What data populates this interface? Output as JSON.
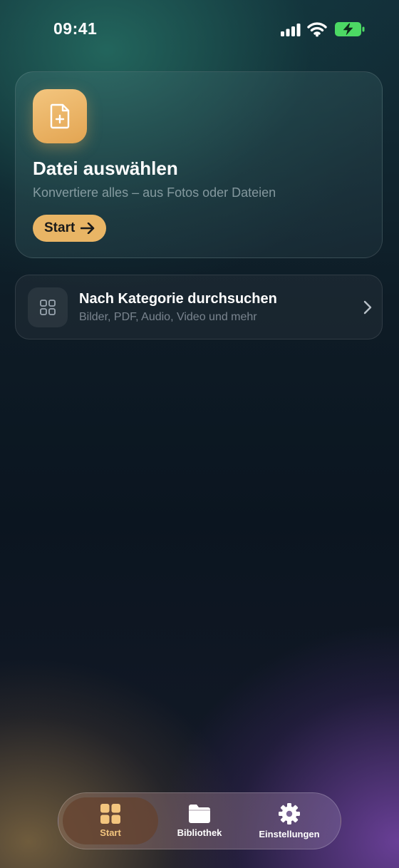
{
  "status_bar": {
    "time": "09:41"
  },
  "upload_card": {
    "title": "Datei auswählen",
    "subtitle": "Konvertiere alles – aus Fotos oder Dateien",
    "button_label": "Start",
    "icon": "file-plus-icon"
  },
  "category_card": {
    "title": "Nach Kategorie durchsuchen",
    "subtitle": "Bilder, PDF, Audio, Video und mehr",
    "icon": "grid-icon"
  },
  "tab_bar": {
    "tabs": [
      {
        "label": "Start",
        "icon": "grid-icon",
        "active": true
      },
      {
        "label": "Bibliothek",
        "icon": "folder-icon",
        "active": false
      },
      {
        "label": "Einstellungen",
        "icon": "gear-icon",
        "active": false
      }
    ]
  },
  "colors": {
    "accent": "#E9B565",
    "battery": "#4CD964",
    "active_tab_text": "#F3C57E"
  }
}
